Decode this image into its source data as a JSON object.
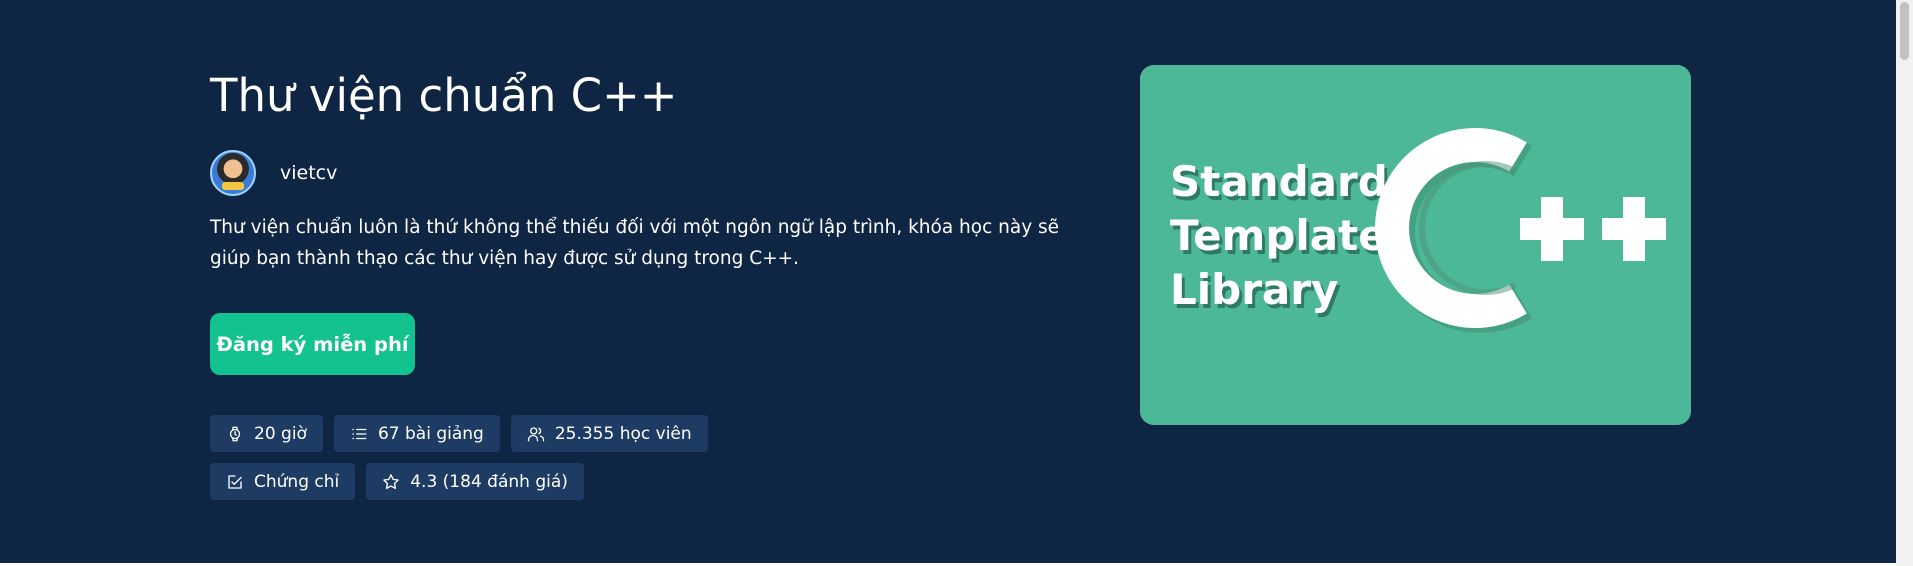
{
  "course": {
    "title": "Thư viện chuẩn C++",
    "author": "vietcv",
    "description": "Thư viện chuẩn luôn là thứ không thể thiếu đối với một ngôn ngữ lập trình, khóa học này sẽ giúp bạn thành thạo các thư viện hay được sử dụng trong C++.",
    "cta_label": "Đăng ký miễn phí",
    "meta": {
      "duration": "20 giờ",
      "lessons": "67 bài giảng",
      "students": "25.355 học viên",
      "certificate": "Chứng chỉ",
      "rating": "4.3 (184 đánh giá)"
    },
    "thumbnail": {
      "line1": "Standard",
      "line2": "Template",
      "line3": "Library",
      "logo_plus": "++"
    }
  },
  "colors": {
    "background": "#0f2544",
    "chip": "#1d3b63",
    "cta": "#14c28f",
    "thumbnail": "#4db897"
  },
  "icons": {
    "duration": "watch-icon",
    "lessons": "list-icon",
    "students": "users-icon",
    "certificate": "certificate-icon",
    "rating": "star-icon"
  }
}
